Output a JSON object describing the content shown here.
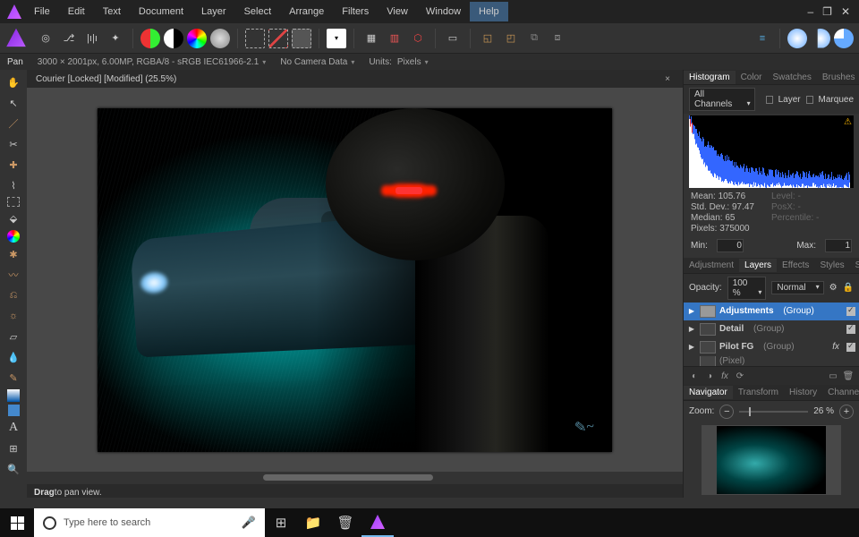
{
  "menu": {
    "items": [
      "File",
      "Edit",
      "Text",
      "Document",
      "Layer",
      "Select",
      "Arrange",
      "Filters",
      "View",
      "Window",
      "Help"
    ],
    "highlighted": "Help"
  },
  "window": {
    "minimize": "–",
    "maximize": "❐",
    "close": "✕"
  },
  "infobar": {
    "tool": "Pan",
    "dims": "3000 × 2001px, 6.00MP, RGBA/8 - sRGB IEC61966-2.1",
    "camera": "No Camera Data",
    "units_label": "Units:",
    "units_value": "Pixels"
  },
  "doc": {
    "title": "Courier [Locked] [Modified] (25.5%)"
  },
  "left_tools": [
    "hand",
    "pointer",
    "brush",
    "crop",
    "heal",
    "lasso",
    "marquee",
    "bucket",
    "hue",
    "liquify",
    "smear",
    "blend",
    "burn",
    "eraser",
    "drop",
    "pencil",
    "grad",
    "shape",
    "text",
    "mesh",
    "zoom"
  ],
  "status": {
    "prefix": "Drag",
    "rest": " to pan view."
  },
  "panels": {
    "hist_tabs": [
      "Histogram",
      "Color",
      "Swatches",
      "Brushes"
    ],
    "hist_active": "Histogram",
    "channel": "All Channels",
    "layer_chk": "Layer",
    "marquee_chk": "Marquee",
    "stats": {
      "mean": "Mean:  105.76",
      "stddev": "Std. Dev.:  97.47",
      "median": "Median:  65",
      "pixels": "Pixels:  375000",
      "level": "Level: -",
      "posx": "PosX: -",
      "percent": "Percentile: -"
    },
    "min_label": "Min:",
    "min_val": "0",
    "max_label": "Max:",
    "max_val": "1",
    "mid_tabs": [
      "Adjustment",
      "Layers",
      "Effects",
      "Styles",
      "Stock"
    ],
    "mid_active": "Layers",
    "opacity_label": "Opacity:",
    "opacity_val": "100 %",
    "blend": "Normal",
    "layers": [
      {
        "name": "Adjustments",
        "suffix": "(Group)",
        "sel": true
      },
      {
        "name": "Detail",
        "suffix": "(Group)"
      },
      {
        "name": "Pilot FG",
        "suffix": "(Group)",
        "fx": true
      },
      {
        "name": "",
        "suffix": "(Pixel)",
        "partial": true
      }
    ],
    "nav_tabs": [
      "Navigator",
      "Transform",
      "History",
      "Channels"
    ],
    "nav_active": "Navigator",
    "zoom_label": "Zoom:",
    "zoom_val": "26 %"
  },
  "taskbar": {
    "search_placeholder": "Type here to search"
  }
}
